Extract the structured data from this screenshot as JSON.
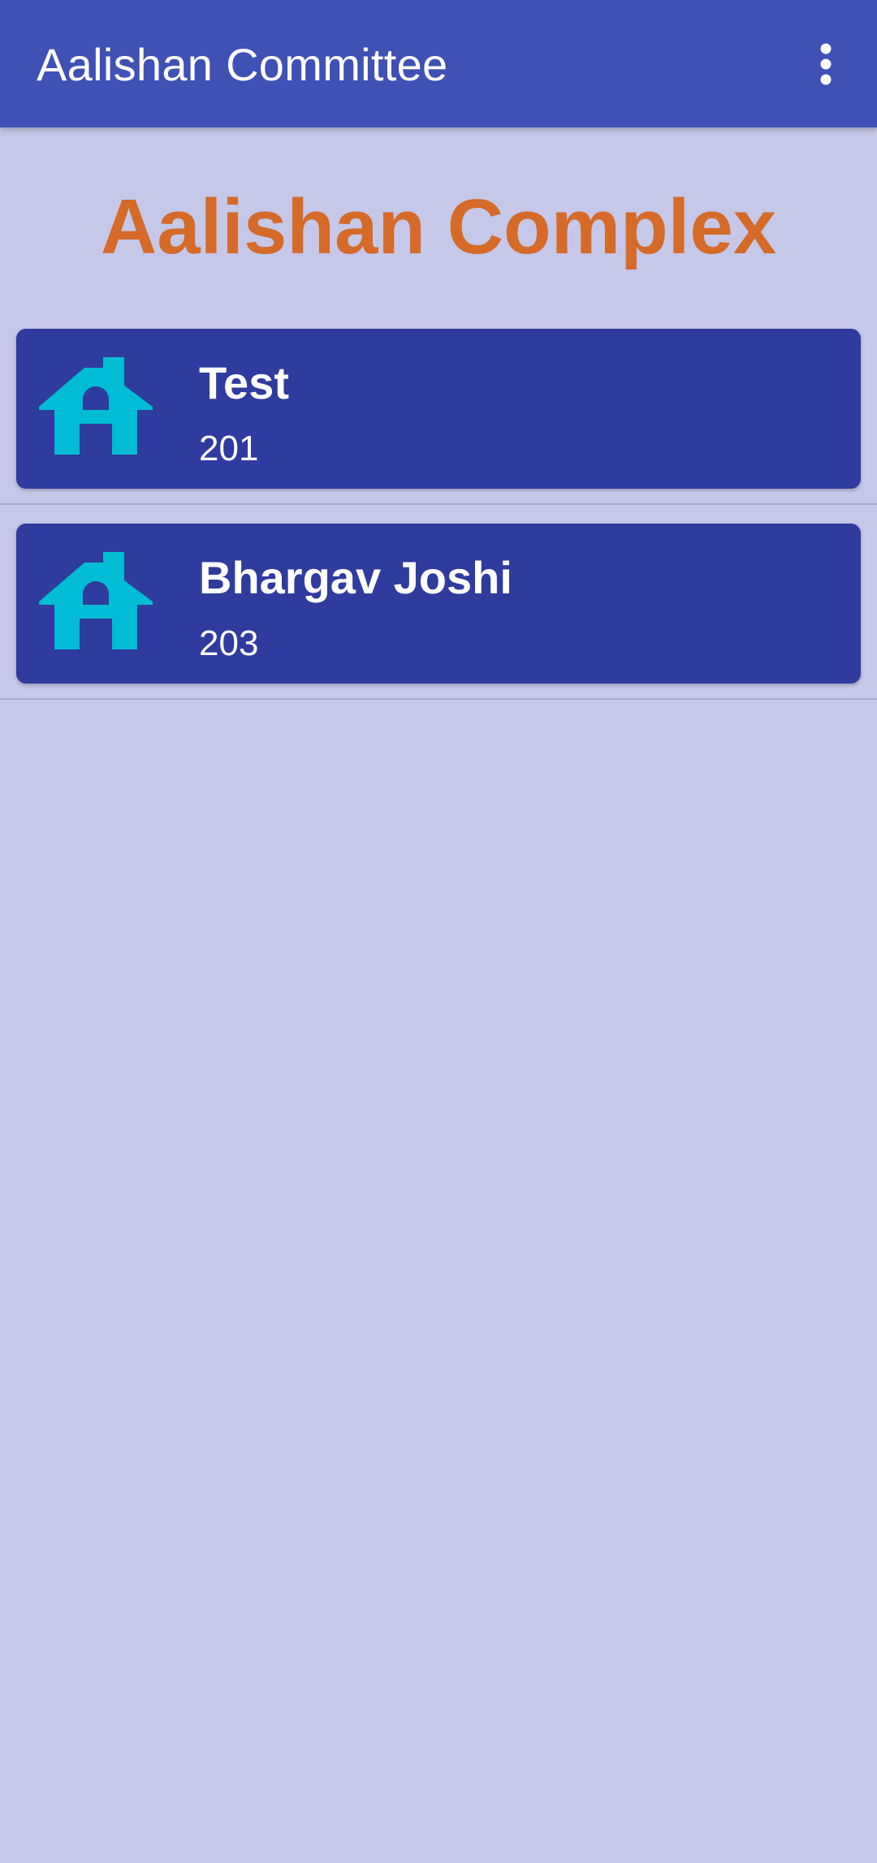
{
  "app_bar": {
    "title": "Aalishan Committee",
    "menu_icon": "more-vert-icon"
  },
  "society": {
    "name": "Aalishan Complex"
  },
  "members": [
    {
      "name": "Test",
      "flat": "201",
      "icon": "house-icon"
    },
    {
      "name": "Bhargav Joshi",
      "flat": "203",
      "icon": "house-icon"
    }
  ],
  "colors": {
    "app_bar": "#3f51b5",
    "background": "#c5c8e8",
    "title_accent": "#d56a29",
    "card": "#2f3b9e",
    "house_icon": "#00bcd4"
  }
}
